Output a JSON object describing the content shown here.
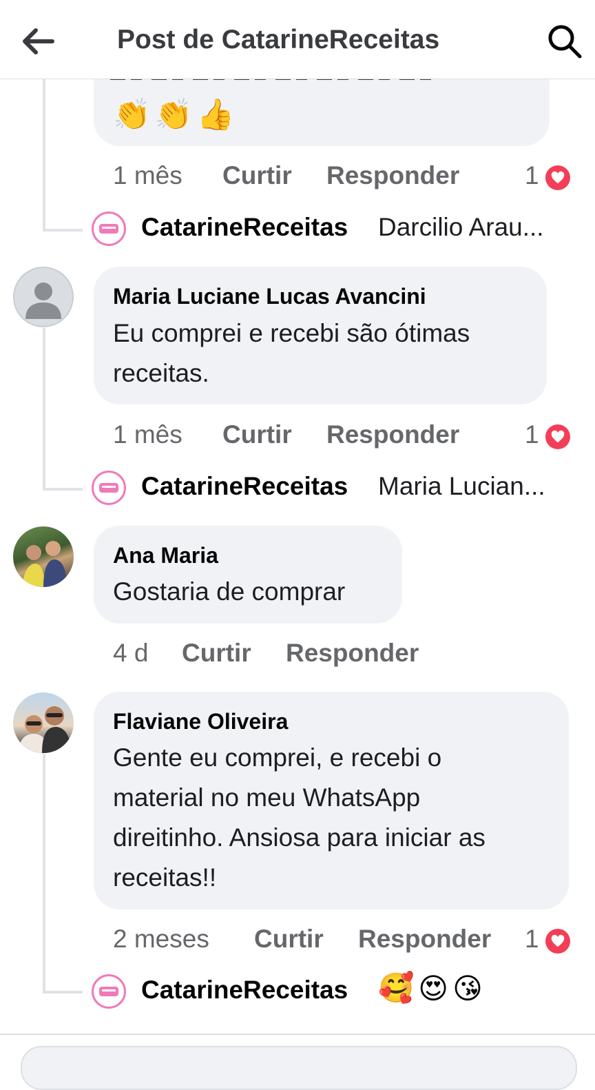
{
  "header": {
    "title": "Post de CatarineReceitas"
  },
  "colors": {
    "heart": "#f33e58",
    "bubble": "#f0f2f5",
    "secondary_text": "#65676b",
    "brand_pink": "#f07ab8"
  },
  "icons": {
    "back": "arrow-left-icon",
    "search": "search-icon",
    "reaction": "heart-icon"
  },
  "comments": [
    {
      "emojis": [
        "👏",
        "👏",
        "👍"
      ],
      "time": "1 mês",
      "like": "Curtir",
      "reply": "Responder",
      "reactions": "1",
      "reply_preview": {
        "author": "CatarineReceitas",
        "text": "Darcilio Arau..."
      }
    },
    {
      "author": "Maria Luciane Lucas Avancini",
      "lines": [
        "Eu comprei e recebi são ótimas",
        "receitas."
      ],
      "time": "1 mês",
      "like": "Curtir",
      "reply": "Responder",
      "reactions": "1",
      "reply_preview": {
        "author": "CatarineReceitas",
        "text": "Maria Lucian..."
      }
    },
    {
      "author": "Ana Maria",
      "lines": [
        "Gostaria de comprar"
      ],
      "time": "4 d",
      "like": "Curtir",
      "reply": "Responder"
    },
    {
      "author": "Flaviane Oliveira",
      "lines": [
        "Gente eu comprei, e recebi o",
        "material no meu WhatsApp",
        "direitinho. Ansiosa para iniciar as",
        "receitas!!"
      ],
      "time": "2 meses",
      "like": "Curtir",
      "reply": "Responder",
      "reactions": "1",
      "reply_preview": {
        "author": "CatarineReceitas",
        "emojis": [
          "🥰",
          "😍",
          "😘"
        ]
      }
    }
  ]
}
